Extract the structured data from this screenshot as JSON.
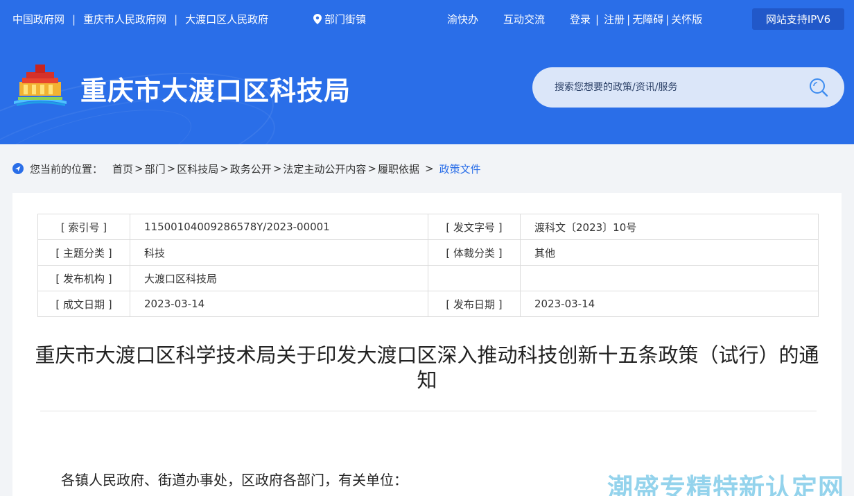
{
  "topbar": {
    "links": [
      "中国政府网",
      "重庆市人民政府网",
      "大渡口区人民政府"
    ],
    "dept_label": "部门街镇",
    "right_links": [
      "渝快办",
      "互动交流"
    ],
    "account_links": [
      "登录",
      "注册",
      "无障碍",
      "关怀版"
    ],
    "ipv6_label": "网站支持IPV6"
  },
  "header": {
    "site_title": "重庆市大渡口区科技局",
    "search_placeholder": "搜索您想要的政策/资讯/服务"
  },
  "breadcrumb": {
    "label": "您当前的位置：",
    "items": [
      "首页",
      "部门",
      "区科技局",
      "政务公开",
      "法定主动公开内容",
      "履职依据"
    ],
    "current": "政策文件"
  },
  "meta": {
    "index_key": "[ 索引号 ]",
    "index_val": "11500104009286578Y/2023-00001",
    "docno_key": "[ 发文字号 ]",
    "docno_val": "渡科文〔2023〕10号",
    "topic_key": "[ 主题分类 ]",
    "topic_val": "科技",
    "genre_key": "[ 体裁分类 ]",
    "genre_val": "其他",
    "issuer_key": "[ 发布机构 ]",
    "issuer_val": "大渡口区科技局",
    "written_key": "[ 成文日期 ]",
    "written_val": "2023-03-14",
    "published_key": "[ 发布日期 ]",
    "published_val": "2023-03-14"
  },
  "document": {
    "title": "重庆市大渡口区科学技术局关于印发大渡口区深入推动科技创新十五条政策（试行）的通知",
    "salutation": "各镇人民政府、街道办事处，区政府各部门，有关单位："
  },
  "watermark": "潮盛专精特新认定网",
  "colors": {
    "header_blue": "#2a6ee8",
    "ipv6_bg": "#2158c9",
    "search_bg": "#dbe6f9",
    "breadcrumb_current": "#2a6ee8",
    "watermark": "#8fd1ec"
  }
}
